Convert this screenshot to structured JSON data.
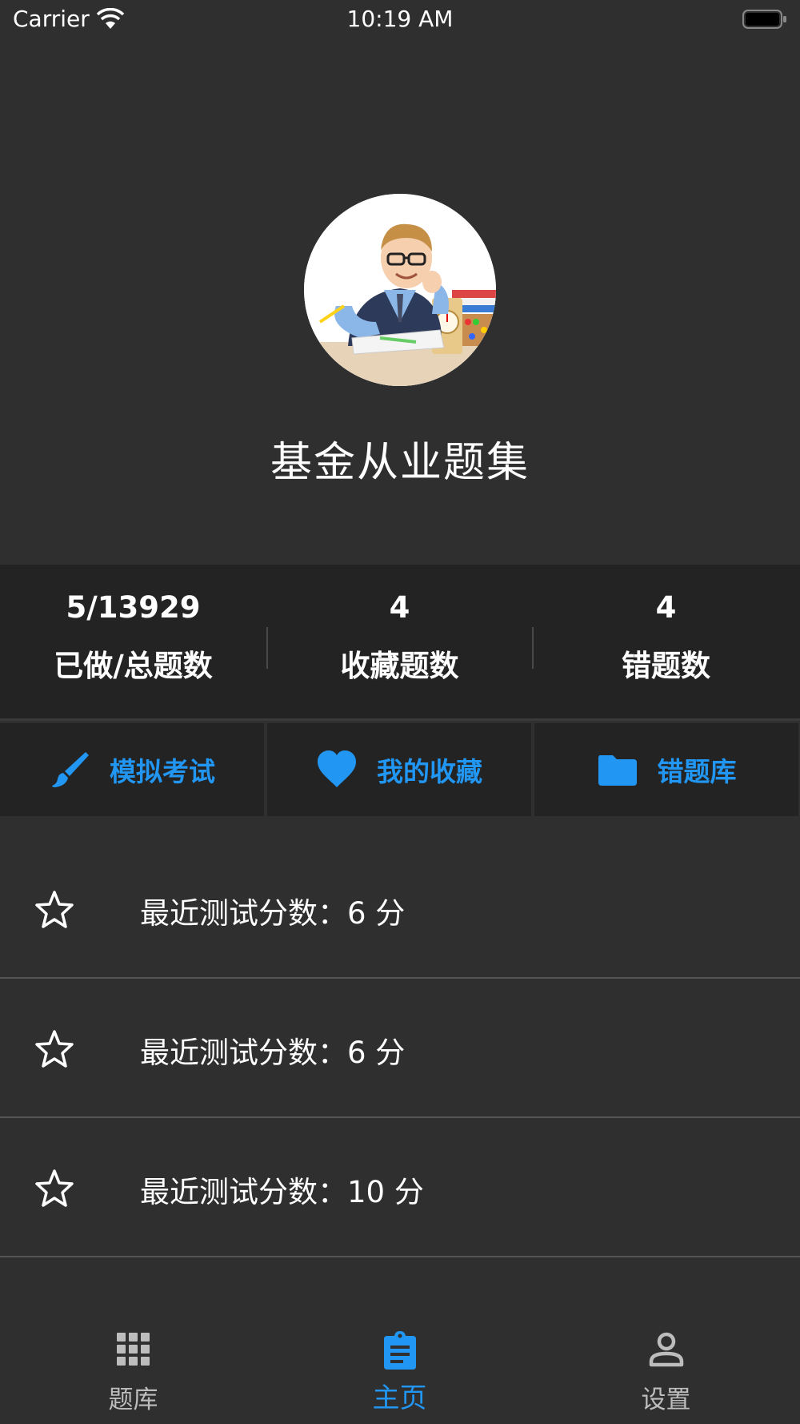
{
  "status_bar": {
    "carrier": "Carrier",
    "time": "10:19 AM"
  },
  "header": {
    "title": "基金从业题集"
  },
  "stats": [
    {
      "value": "5/13929",
      "label": "已做/总题数"
    },
    {
      "value": "4",
      "label": "收藏题数"
    },
    {
      "value": "4",
      "label": "错题数"
    }
  ],
  "actions": [
    {
      "label": "模拟考试",
      "icon": "brush-icon"
    },
    {
      "label": "我的收藏",
      "icon": "heart-icon"
    },
    {
      "label": "错题库",
      "icon": "folder-icon"
    }
  ],
  "recent_scores": [
    {
      "text": "最近测试分数：6 分"
    },
    {
      "text": "最近测试分数：6 分"
    },
    {
      "text": "最近测试分数：10 分"
    }
  ],
  "bottom_nav": [
    {
      "label": "题库",
      "icon": "grid-icon",
      "active": false
    },
    {
      "label": "主页",
      "icon": "clipboard-icon",
      "active": true
    },
    {
      "label": "设置",
      "icon": "person-icon",
      "active": false
    }
  ],
  "colors": {
    "accent": "#2196f3",
    "background": "#2f2f30",
    "panel": "#232323"
  }
}
